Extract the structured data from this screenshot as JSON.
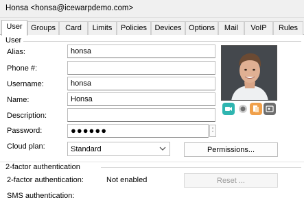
{
  "window": {
    "title": "Honsa <honsa@icewarpdemo.com>"
  },
  "tabs": [
    {
      "label": "User",
      "active": true
    },
    {
      "label": "Groups"
    },
    {
      "label": "Card"
    },
    {
      "label": "Limits"
    },
    {
      "label": "Policies"
    },
    {
      "label": "Devices"
    },
    {
      "label": "Options"
    },
    {
      "label": "Mail"
    },
    {
      "label": "VoIP"
    },
    {
      "label": "Rules"
    }
  ],
  "user_group": {
    "title": "User",
    "alias": {
      "label": "Alias:",
      "value": "honsa"
    },
    "phone": {
      "label": "Phone #:",
      "value": ""
    },
    "username": {
      "label": "Username:",
      "value": "honsa"
    },
    "name": {
      "label": "Name:",
      "value": "Honsa"
    },
    "description": {
      "label": "Description:",
      "value": ""
    },
    "password": {
      "label": "Password:",
      "value": "●●●●●●",
      "more": ":"
    },
    "cloud_plan": {
      "label": "Cloud plan:",
      "value": "Standard"
    },
    "permissions_button": "Permissions..."
  },
  "avatar_icons": [
    "video-call-icon",
    "status-dot-icon",
    "document-icon",
    "id-card-icon"
  ],
  "twofa_group": {
    "title": "2-factor authentication",
    "status_label": "2-factor authentication:",
    "status_value": "Not enabled",
    "reset_button": "Reset ...",
    "sms_label": "SMS authentication:"
  },
  "colors": {
    "accent_teal": "#2fb5b0",
    "accent_orange": "#f0a04b",
    "accent_gray": "#6e6e6e"
  }
}
